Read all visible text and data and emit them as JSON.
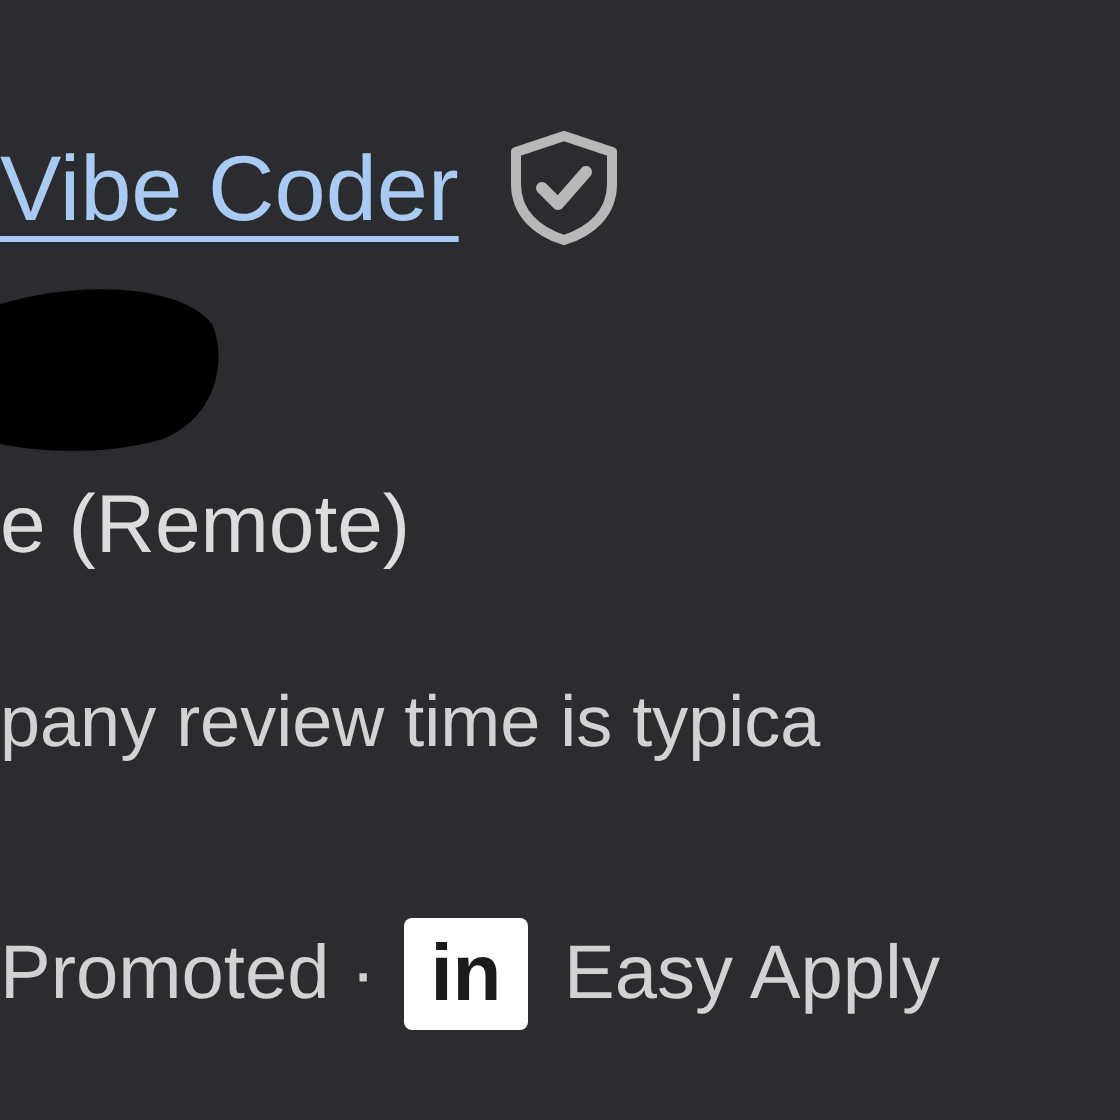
{
  "job": {
    "title": "Vibe Coder",
    "verified": true,
    "location": "e (Remote)",
    "review_note": "pany review time is typica",
    "footer": {
      "promoted": "Promoted ·",
      "logo_text": "in",
      "apply": "Easy Apply"
    }
  }
}
